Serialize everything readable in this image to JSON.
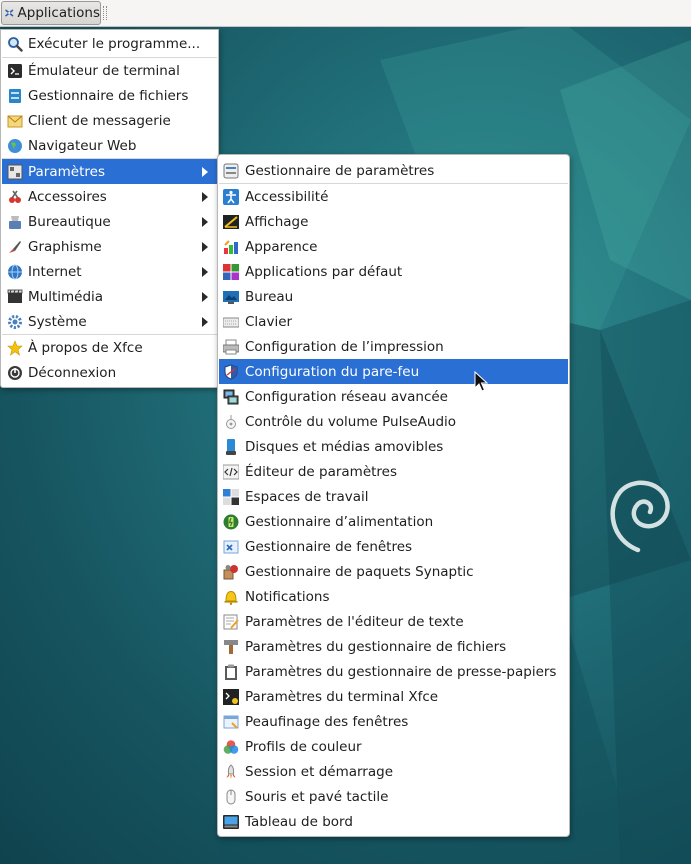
{
  "panel": {
    "app_button_label": "Applications"
  },
  "main_menu": {
    "items": [
      {
        "label": "Exécuter le programme...",
        "icon": "run-icon"
      },
      {
        "label": "Émulateur de terminal",
        "icon": "terminal-icon"
      },
      {
        "label": "Gestionnaire de fichiers",
        "icon": "file-manager-icon"
      },
      {
        "label": "Client de messagerie",
        "icon": "mail-icon"
      },
      {
        "label": "Navigateur Web",
        "icon": "web-browser-icon"
      },
      {
        "label": "Paramètres",
        "icon": "settings-icon",
        "submenu": true,
        "active": true
      },
      {
        "label": "Accessoires",
        "icon": "accessories-icon",
        "submenu": true
      },
      {
        "label": "Bureautique",
        "icon": "office-icon",
        "submenu": true
      },
      {
        "label": "Graphisme",
        "icon": "graphics-icon",
        "submenu": true
      },
      {
        "label": "Internet",
        "icon": "internet-icon",
        "submenu": true
      },
      {
        "label": "Multimédia",
        "icon": "multimedia-icon",
        "submenu": true
      },
      {
        "label": "Système",
        "icon": "system-icon",
        "submenu": true
      },
      {
        "label": "À propos de Xfce",
        "icon": "about-star-icon"
      },
      {
        "label": "Déconnexion",
        "icon": "logout-icon"
      }
    ]
  },
  "sub_menu": {
    "items": [
      {
        "label": "Gestionnaire de paramètres"
      },
      {
        "label": "Accessibilité"
      },
      {
        "label": "Affichage"
      },
      {
        "label": "Apparence"
      },
      {
        "label": "Applications par défaut"
      },
      {
        "label": "Bureau"
      },
      {
        "label": "Clavier"
      },
      {
        "label": "Configuration de l’impression"
      },
      {
        "label": "Configuration du pare-feu",
        "active": true
      },
      {
        "label": "Configuration réseau avancée"
      },
      {
        "label": "Contrôle du volume PulseAudio"
      },
      {
        "label": "Disques et médias amovibles"
      },
      {
        "label": "Éditeur de paramètres"
      },
      {
        "label": "Espaces de travail"
      },
      {
        "label": "Gestionnaire d’alimentation"
      },
      {
        "label": "Gestionnaire de fenêtres"
      },
      {
        "label": "Gestionnaire de paquets Synaptic"
      },
      {
        "label": "Notifications"
      },
      {
        "label": "Paramètres de l'éditeur de texte"
      },
      {
        "label": "Paramètres du gestionnaire de fichiers"
      },
      {
        "label": "Paramètres du gestionnaire de presse-papiers"
      },
      {
        "label": "Paramètres du terminal Xfce"
      },
      {
        "label": "Peaufinage des fenêtres"
      },
      {
        "label": "Profils de couleur"
      },
      {
        "label": "Session et démarrage"
      },
      {
        "label": "Souris et pavé tactile"
      },
      {
        "label": "Tableau de bord"
      }
    ]
  },
  "colors": {
    "highlight": "#2a6fd3",
    "menu_bg": "#ffffff",
    "panel_bg": "#f6f5f4"
  }
}
